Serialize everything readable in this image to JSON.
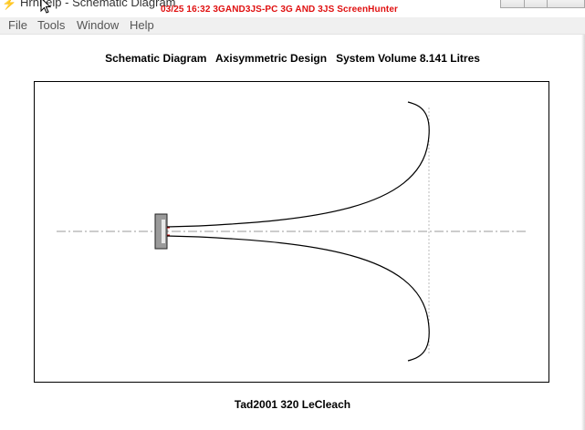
{
  "window": {
    "title": "Hrnhelp - Schematic Diagram",
    "app_icon": "lightning-icon",
    "overlay": "03/25  16:32  3GAND3JS-PC  3G AND 3JS  ScreenHunter",
    "overlay_color": "#e01010"
  },
  "menu": {
    "items": [
      {
        "label": "File"
      },
      {
        "label": "Tools"
      },
      {
        "label": "Window"
      },
      {
        "label": "Help"
      }
    ]
  },
  "diagram": {
    "heading": "Schematic Diagram   Axisymmetric Design   System Volume 8.141 Litres",
    "caption": "Tad2001 320 LeCleach",
    "driver_color": "#999999",
    "throat_mark_color": "#cc0000",
    "centerline_color": "#999999",
    "profile_color": "#000000"
  }
}
